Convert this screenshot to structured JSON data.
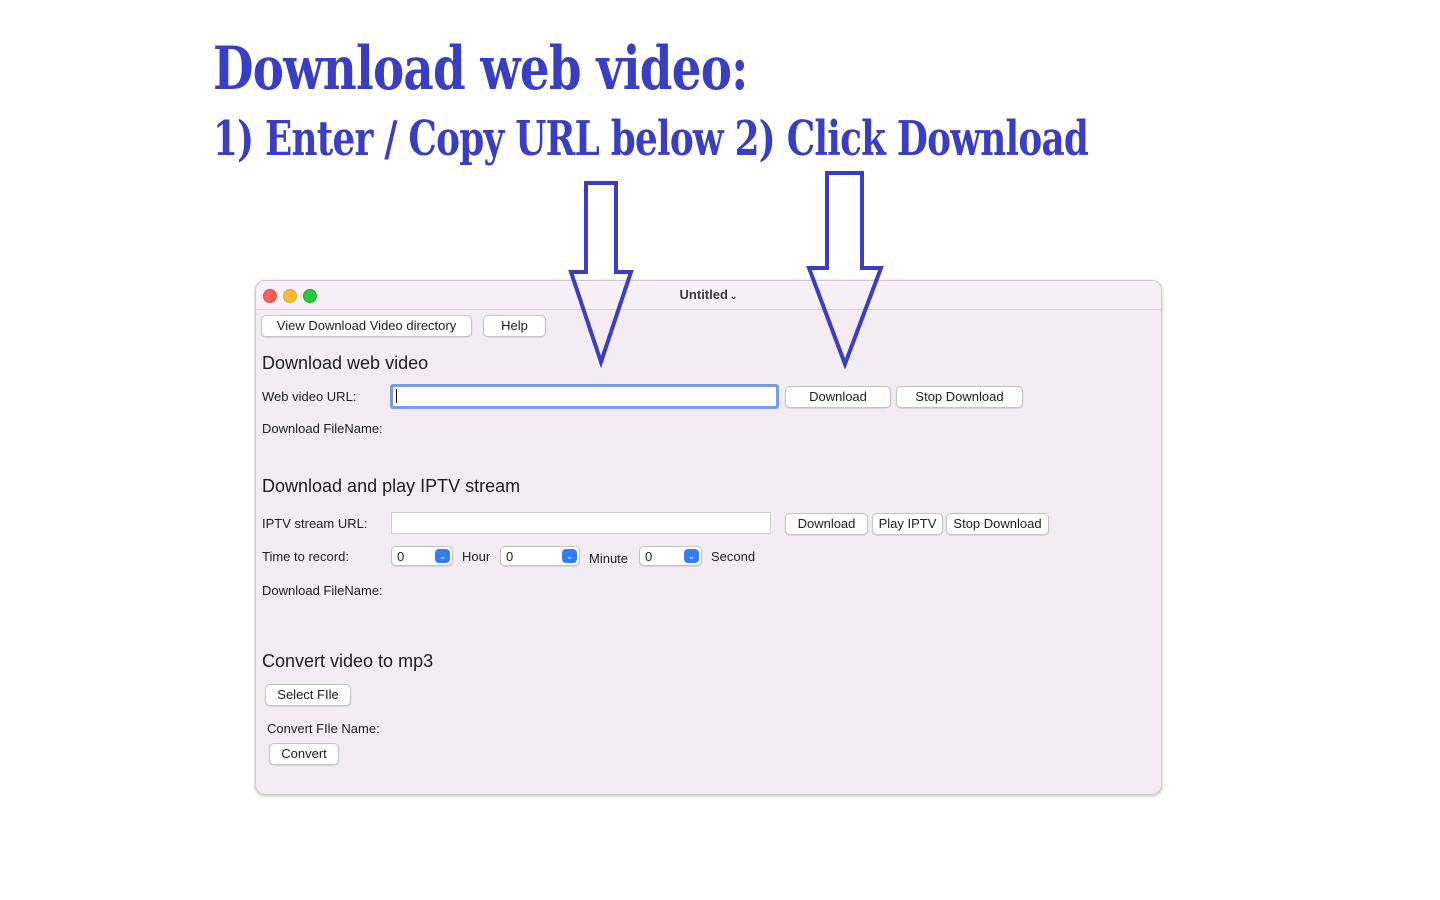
{
  "headline": {
    "line1": "Download web video:",
    "line2": "1)  Enter / Copy URL below 2) Click Download"
  },
  "window": {
    "title": "Untitled",
    "title_chevron": "⌄",
    "toolbar": {
      "view_dir_label": "View Download Video directory",
      "help_label": "Help"
    },
    "web": {
      "section_title": "Download  web video",
      "url_label": "Web video URL:",
      "url_value": "",
      "download_label": "Download",
      "stop_label": "Stop Download",
      "filename_label": "Download FileName:"
    },
    "iptv": {
      "section_title": "Download  and play IPTV stream",
      "url_label": "IPTV stream URL:",
      "url_value": "",
      "download_label": "Download",
      "play_label": "Play IPTV",
      "stop_label": "Stop Download",
      "time_label": "Time to record:",
      "hour_value": "0",
      "hour_unit": "Hour",
      "minute_value": "0",
      "minute_unit": "Minute",
      "second_value": "0",
      "second_unit": "Second",
      "filename_label": "Download FileName:"
    },
    "convert": {
      "section_title": "Convert video to mp3",
      "select_label": "Select FIle",
      "name_label": "Convert FIle Name:",
      "convert_label": "Convert"
    }
  },
  "colors": {
    "headline": "#3a3fc2",
    "window_bg": "#f3edf3",
    "focus_ring": "#7b9be8",
    "stepper": "#2f7cf6"
  }
}
